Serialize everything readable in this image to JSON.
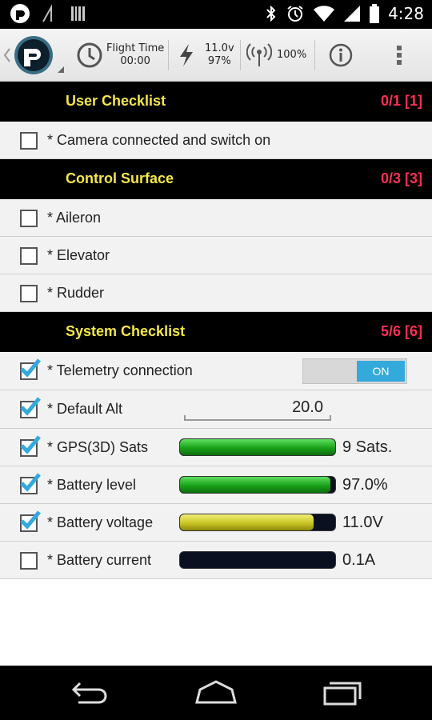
{
  "status_bar": {
    "time": "4:28",
    "icons": [
      "app-notification-icon",
      "signal-off-icon",
      "barcode-icon",
      "bluetooth-icon",
      "alarm-icon",
      "wifi-icon",
      "cell-signal-icon",
      "battery-icon"
    ]
  },
  "action_bar": {
    "flight_time_label": "Flight Time",
    "flight_time_value": "00:00",
    "battery_voltage": "11.0v",
    "battery_percent": "97%",
    "signal_percent": "100%"
  },
  "sections": {
    "user": {
      "title": "User Checklist",
      "count": "0/1 [1]",
      "items": [
        {
          "label": "* Camera connected and switch on",
          "checked": false
        }
      ]
    },
    "control": {
      "title": "Control Surface",
      "count": "0/3 [3]",
      "items": [
        {
          "label": "* Aileron",
          "checked": false
        },
        {
          "label": "* Elevator",
          "checked": false
        },
        {
          "label": "* Rudder",
          "checked": false
        }
      ]
    },
    "system": {
      "title": "System Checklist",
      "count": "5/6 [6]",
      "items": [
        {
          "label": "* Telemetry connection",
          "checked": true,
          "toggle": "ON"
        },
        {
          "label": "* Default Alt",
          "checked": true,
          "value": "20.0"
        },
        {
          "label": "* GPS(3D) Sats",
          "checked": true,
          "value": "9 Sats.",
          "fill": 1.0,
          "color": "green"
        },
        {
          "label": "* Battery level",
          "checked": true,
          "value": "97.0%",
          "fill": 0.97,
          "color": "green"
        },
        {
          "label": "* Battery voltage",
          "checked": true,
          "value": "11.0V",
          "fill": 0.86,
          "color": "yellow"
        },
        {
          "label": "* Battery current",
          "checked": false,
          "value": "0.1A",
          "fill": 0.0,
          "color": "green"
        }
      ]
    }
  },
  "colors": {
    "section_title": "#f5e64a",
    "section_count": "#ff2d55",
    "check_accent": "#33a9dc",
    "toggle_on": "#33a9dc"
  }
}
